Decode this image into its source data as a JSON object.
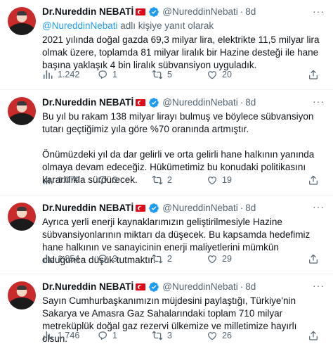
{
  "tweets": [
    {
      "author": {
        "name": "Dr.Nureddin NEBATİ",
        "handle": "@NureddinNebati",
        "flag_icon": "turkish-flag-icon",
        "verified_icon": "verified-badge-icon"
      },
      "time": "8d",
      "reply_to": {
        "user": "@NureddinNebati",
        "suffix": "adlı kişiye yanıt olarak"
      },
      "paragraphs": [
        "2021 yılında doğal gazda 69,3 milyar lira, elektrikte 11,5 milyar lira olmak üzere, toplamda 81 milyar liralık bir Hazine desteği ile hane başına yaklaşık 4 bin liralık sübvansiyon uyguladık."
      ],
      "views": "1.242",
      "replies": "1",
      "retweets": "5",
      "likes": "20"
    },
    {
      "author": {
        "name": "Dr.Nureddin NEBATİ",
        "handle": "@NureddinNebati",
        "flag_icon": "turkish-flag-icon",
        "verified_icon": "verified-badge-icon"
      },
      "time": "8d",
      "paragraphs": [
        "Bu yıl bu rakam 138 milyar lirayı bulmuş ve böylece sübvansiyon tutarı geçtiğimiz yıla göre %70 oranında artmıştır.",
        "Önümüzdeki yıl da dar gelirli ve orta gelirli hane halkının yanında olmaya devam edeceğiz. Hükümetimiz bu konudaki politikasını kararlılıkla sürdürecek."
      ],
      "views": "1.079",
      "replies": "3",
      "retweets": "2",
      "likes": "19"
    },
    {
      "author": {
        "name": "Dr.Nureddin NEBATİ",
        "handle": "@NureddinNebati",
        "flag_icon": "turkish-flag-icon",
        "verified_icon": "verified-badge-icon"
      },
      "time": "8d",
      "paragraphs": [
        "Ayrıca yerli enerji kaynaklarımızın geliştirilmesiyle Hazine sübvansiyonlarının miktarı da düşecek. Bu kapsamda hedefimiz hane halkının ve sanayicinin enerji maliyetlerini mümkün olduğunca düşük tutmaktır."
      ],
      "views": "1.854",
      "replies": "3",
      "retweets": "2",
      "likes": "29"
    },
    {
      "author": {
        "name": "Dr.Nureddin NEBATİ",
        "handle": "@NureddinNebati",
        "flag_icon": "turkish-flag-icon",
        "verified_icon": "verified-badge-icon"
      },
      "time": "8d",
      "paragraphs": [
        "Sayın Cumhurbaşkanımızın müjdesini paylaştığı, Türkiye'nin Sakarya ve Amasra Gaz Sahalarındaki toplam 710 milyar metreküplük doğal gaz rezervi ülkemize ve milletimize hayırlı olsun."
      ],
      "views": "1.746",
      "replies": "1",
      "retweets": "3",
      "likes": "26"
    }
  ],
  "colors": {
    "text": "#0f1419",
    "secondary": "#536471",
    "link": "#1d9bf0",
    "verified": "#1d9bf0",
    "flag": "#e30a17",
    "divider": "#eff3f4"
  },
  "icons": {
    "more": "more-options-icon",
    "views": "views-icon",
    "reply": "reply-icon",
    "retweet": "retweet-icon",
    "like": "like-icon",
    "share": "share-icon"
  }
}
